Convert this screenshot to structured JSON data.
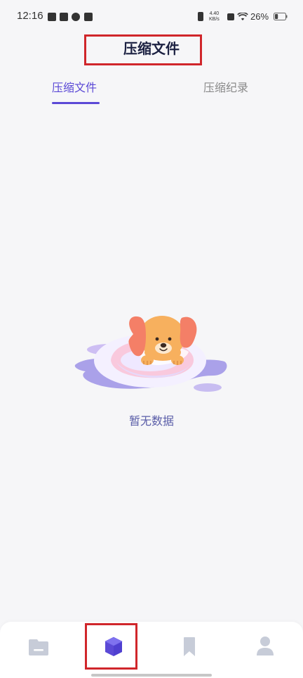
{
  "status_bar": {
    "time": "12:16",
    "network_speed_value": "4.40",
    "network_speed_unit": "KB/s",
    "battery": "26%"
  },
  "header": {
    "title": "压缩文件"
  },
  "tabs": [
    {
      "label": "压缩文件",
      "active": true
    },
    {
      "label": "压缩纪录",
      "active": false
    }
  ],
  "empty_state": {
    "message": "暂无数据"
  },
  "bottom_nav": {
    "items": [
      {
        "icon": "folder-icon",
        "active": false
      },
      {
        "icon": "box-icon",
        "active": true
      },
      {
        "icon": "bookmark-icon",
        "active": false
      },
      {
        "icon": "user-icon",
        "active": false
      }
    ]
  },
  "colors": {
    "accent": "#5b49d6",
    "highlight_box": "#d0262b",
    "inactive_icon": "#c7ccd8"
  }
}
